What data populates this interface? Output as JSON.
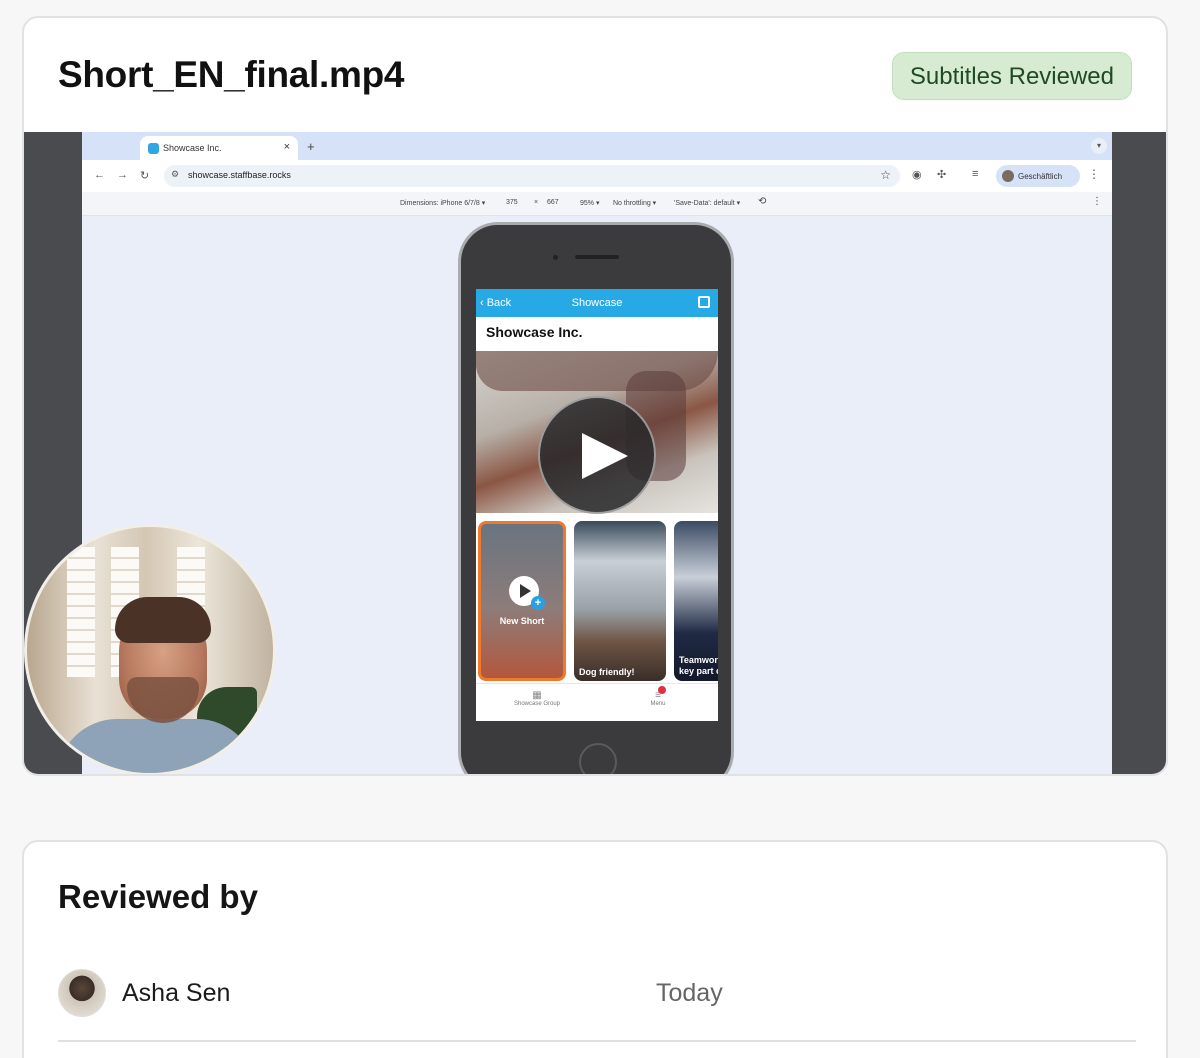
{
  "video_card": {
    "title": "Short_EN_final.mp4",
    "status_badge": "Subtitles Reviewed"
  },
  "recording": {
    "browser": {
      "tab_title": "Showcase Inc.",
      "tab_close": "×",
      "new_tab": "+",
      "url": "showcase.staffbase.rocks",
      "profile_label": "Geschäftlich"
    },
    "devtools": {
      "dimensions": "Dimensions: iPhone 6/7/8 ▾",
      "width": "375",
      "times": "×",
      "height": "667",
      "zoom": "95% ▾",
      "throttling": "No throttling ▾",
      "save_data": "'Save-Data': default ▾"
    },
    "app": {
      "back_label": "‹ Back",
      "header_title": "Showcase",
      "page_heading": "Showcase Inc.",
      "shorts": [
        {
          "label": "New Short"
        },
        {
          "label": "Dog friendly!"
        },
        {
          "label": "Teamwor key part o"
        }
      ],
      "nav": [
        {
          "label": "Showcase Group"
        },
        {
          "label": "Menu"
        }
      ]
    }
  },
  "review_card": {
    "heading": "Reviewed by",
    "reviews": [
      {
        "name": "Asha Sen",
        "date": "Today"
      }
    ]
  },
  "colors": {
    "badge_bg": "#d7ebd3",
    "badge_text": "#1f4a24",
    "app_header": "#27a9e6",
    "new_short_border": "#ef7a2c"
  }
}
